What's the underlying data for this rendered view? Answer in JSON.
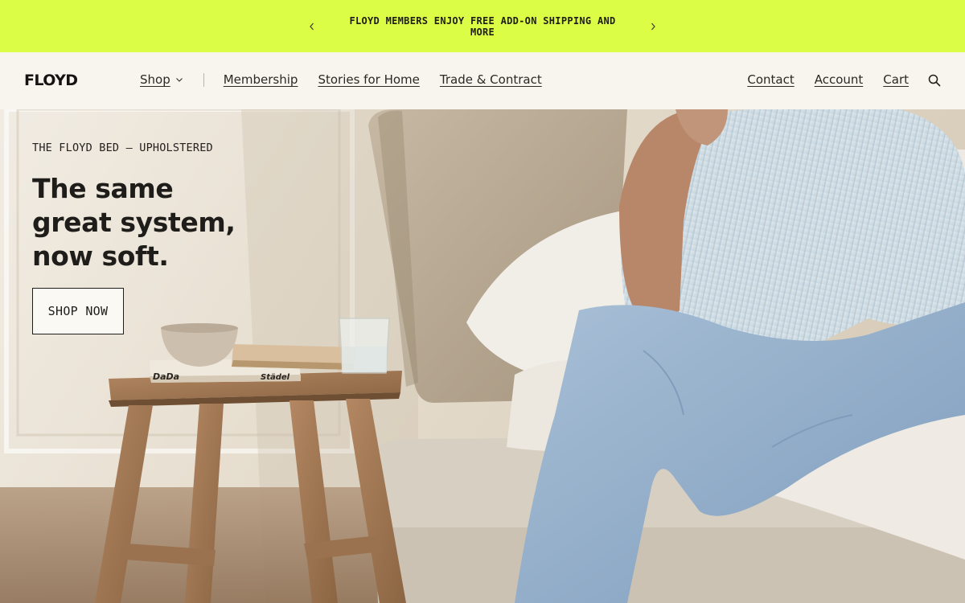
{
  "promo": {
    "text": "FLOYD MEMBERS ENJOY FREE ADD-ON SHIPPING AND MORE",
    "prev_icon": "chevron-left-icon",
    "next_icon": "chevron-right-icon",
    "background": "#dcfd45"
  },
  "header": {
    "logo": "FLOYD",
    "nav_left": {
      "shop": "Shop",
      "membership": "Membership",
      "stories": "Stories for Home",
      "trade": "Trade & Contract"
    },
    "nav_right": {
      "contact": "Contact",
      "account": "Account",
      "cart": "Cart"
    },
    "search_icon": "search-icon"
  },
  "hero": {
    "eyebrow": "THE FLOYD BED — UPHOLSTERED",
    "headline": [
      "The same",
      "great system,",
      "now soft."
    ],
    "cta": "SHOP NOW",
    "book_labels": [
      "DaDa",
      "Städel"
    ]
  }
}
